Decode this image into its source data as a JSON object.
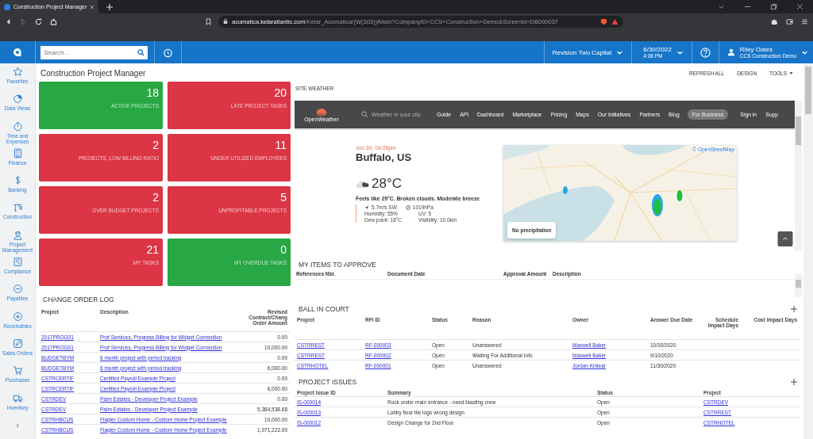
{
  "browser": {
    "tab_title": "Construction Project Manager",
    "url_domain": "acumatica.kelaratlantic.com",
    "url_path": "/Kelar_Acumatica/(W(303))/Main?CompanyID=CCS+Construction+Demo&ScreenId=DB000037"
  },
  "top_bar": {
    "search_placeholder": "Search...",
    "company": "Revision Two Capital",
    "date": "6/30/2022",
    "time": "4:08 PM",
    "user_name": "Riley Oates",
    "user_company": "CCS Construction Demo"
  },
  "sidebar": {
    "items": [
      {
        "label": "Favorites"
      },
      {
        "label": "Data Views"
      },
      {
        "label": "Time and Expenses"
      },
      {
        "label": "Finance"
      },
      {
        "label": "Banking"
      },
      {
        "label": "Construction"
      },
      {
        "label": "Project Management"
      },
      {
        "label": "Compliance"
      },
      {
        "label": "Payables"
      },
      {
        "label": "Receivables"
      },
      {
        "label": "Sales Orders"
      },
      {
        "label": "Purchases"
      },
      {
        "label": "Inventory"
      }
    ]
  },
  "page_title": "Construction Project Manager",
  "actions": [
    "REFRESH ALL",
    "DESIGN",
    "TOOLS"
  ],
  "tiles": [
    {
      "value": "18",
      "label": "ACTIVE PROJECTS",
      "color": "#28a745"
    },
    {
      "value": "20",
      "label": "LATE PROJECT TASKS",
      "color": "#dc3545"
    },
    {
      "value": "2",
      "label": "PROJECTS, LOW BILLING RATIO",
      "color": "#dc3545"
    },
    {
      "value": "11",
      "label": "UNDER UTILIZED EMPLOYEES",
      "color": "#dc3545"
    },
    {
      "value": "2",
      "label": "OVER BUDGET PROJECTS",
      "color": "#dc3545"
    },
    {
      "value": "5",
      "label": "UNPROFITABLE PROJECTS",
      "color": "#dc3545"
    },
    {
      "value": "21",
      "label": "MY TASKS",
      "color": "#dc3545"
    },
    {
      "value": "0",
      "label": "MY OVERDUE TASKS",
      "color": "#28a745"
    }
  ],
  "change_order_log": {
    "title": "CHANGE ORDER LOG",
    "columns": [
      {
        "label": "Project",
        "kind": "link"
      },
      {
        "label": "Description",
        "kind": "link"
      },
      {
        "label": "Revised Contract/Chang Order Amount",
        "kind": "amount"
      }
    ],
    "rows": [
      [
        "2017PROG01",
        "Prof Services, Progress Billing for Widget Connection",
        "0.00"
      ],
      [
        "2017PROG01",
        "Prof Services, Progress Billing for Widget Connection",
        "10,000.00"
      ],
      [
        "BUDGETBYM",
        "6 month project with period tracking",
        "0.00"
      ],
      [
        "BUDGETBYM",
        "6 month project with period tracking",
        "6,000.00"
      ],
      [
        "CSTRCERTIF",
        "Certified Payroll Example Project",
        "0.00"
      ],
      [
        "CSTRCERTIF",
        "Certified Payroll Example Project",
        "6,000.00"
      ],
      [
        "CSTRDEV",
        "Palm Estates - Developer Project Example",
        "0.00"
      ],
      [
        "CSTRDEV",
        "Palm Estates - Developer Project Example",
        "5,384,538.68"
      ],
      [
        "CSTRHBCUS",
        "Flagler Custom Home - Custom Home Project Example",
        "10,000.00"
      ],
      [
        "CSTRHBCUS",
        "Flagler Custom Home - Custom Home Project Example",
        "1,971,223.00"
      ]
    ]
  },
  "site_weather": {
    "title": "SITE WEATHER",
    "brand": "OpenWeather",
    "search_placeholder": "Weather in your city",
    "nav": [
      {
        "label": "Guide",
        "kind": "link"
      },
      {
        "label": "API",
        "kind": "link"
      },
      {
        "label": "Dashboard",
        "kind": "link"
      },
      {
        "label": "Marketplace",
        "kind": "link"
      },
      {
        "label": "Pricing",
        "kind": "link"
      },
      {
        "label": "Maps",
        "kind": "link"
      },
      {
        "label": "Our Initiatives",
        "kind": "link"
      },
      {
        "label": "Partners",
        "kind": "link"
      },
      {
        "label": "Blog",
        "kind": "link"
      },
      {
        "label": "For Business",
        "kind": "pill"
      },
      {
        "label": "Sign in",
        "kind": "link"
      },
      {
        "label": "Supp",
        "kind": "link"
      }
    ],
    "date": "Jun 30, 04:05pm",
    "city": "Buffalo, US",
    "temperature": "28°C",
    "summary": "Feels like 29°C. Broken clouds. Moderate breeze",
    "wind": "5.7m/s SW",
    "pressure": "1019hPa",
    "details": [
      [
        "Humidity:",
        "55%"
      ],
      [
        "UV:",
        "5"
      ],
      [
        "Dew point:",
        "18°C"
      ],
      [
        "Visibility:",
        "10.0km"
      ]
    ],
    "map_attribution": "© OpenStreetMap",
    "map_popup": "No precipitation"
  },
  "my_items_to_approve": {
    "title": "MY ITEMS TO APPROVE",
    "columns": [
      "References Nbr.",
      "Document Date",
      "Approval Amount",
      "Description"
    ]
  },
  "ball_in_court": {
    "title": "BALL IN COURT",
    "columns": [
      {
        "label": "Project",
        "kind": "link"
      },
      {
        "label": "RFI ID",
        "kind": "link"
      },
      {
        "label": "Status",
        "kind": "text"
      },
      {
        "label": "Reason",
        "kind": "text"
      },
      {
        "label": "Owner",
        "kind": "link"
      },
      {
        "label": "Answer Due Date",
        "kind": "text"
      },
      {
        "label": "Schedule Impact Days",
        "kind": "amount"
      },
      {
        "label": "Cost Impact Days",
        "kind": "amount"
      }
    ],
    "rows": [
      [
        "CSTRREST",
        "RF-000003",
        "Open",
        "Unanswered",
        "Maxwell Baker",
        "10/30/2020",
        null,
        null
      ],
      [
        "CSTRREST",
        "RF-000002",
        "Open",
        "Waiting For Additional Info",
        "Maxwell Baker",
        "9/10/2020",
        null,
        null
      ],
      [
        "CSTRHOTEL",
        "RF-000001",
        "Open",
        "Unanswered",
        "Jordan Kinlear",
        "11/30/2020",
        null,
        null
      ]
    ]
  },
  "project_issues": {
    "title": "PROJECT ISSUES",
    "columns": [
      {
        "label": "Project Issue ID",
        "kind": "link"
      },
      {
        "label": "Summary",
        "kind": "text"
      },
      {
        "label": "Status",
        "kind": "text"
      },
      {
        "label": "Project",
        "kind": "link"
      }
    ],
    "rows": [
      [
        "IS-000014",
        "Rock under main entrance - need blasting crew",
        "Open",
        "CSTRDEV"
      ],
      [
        "IS-000013",
        "Lobby floor tile logo wrong design",
        "Open",
        "CSTRREST"
      ],
      [
        "IS-000012",
        "Design Change for 2nd Floor",
        "Open",
        "CSTRHOTEL"
      ]
    ]
  }
}
